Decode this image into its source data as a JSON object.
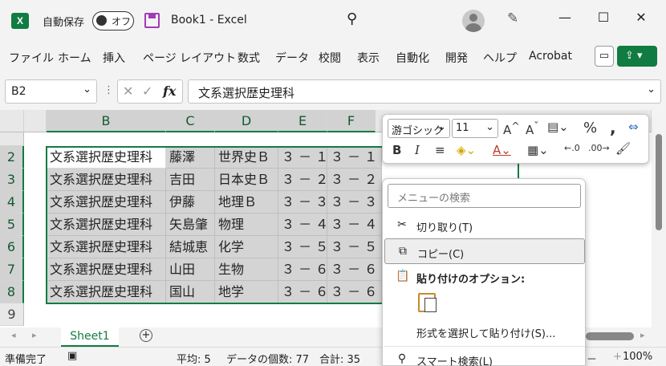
{
  "titlebar": {
    "app_icon": "X",
    "autosave_label": "自動保存",
    "autosave_state": "オフ",
    "doc_title": "Book1  -  Excel",
    "icons": [
      "excel-logo-icon",
      "save-icon",
      "search-icon",
      "avatar",
      "pen-icon"
    ],
    "minimize": "—",
    "maximize": "☐",
    "close": "✕"
  },
  "ribbon": {
    "tabs": [
      "ファイル",
      "ホーム",
      "挿入",
      "ページ レイアウト",
      "数式",
      "データ",
      "校閲",
      "表示",
      "自動化",
      "開発",
      "ヘルプ",
      "Acrobat"
    ],
    "comment_icon": "comment-icon",
    "share_icon": "share-icon"
  },
  "formula_bar": {
    "name_box": "B2",
    "formula": "文系選択歴史理科",
    "fx_label": "fx"
  },
  "grid": {
    "columns": [
      "B",
      "C",
      "D",
      "E",
      "F"
    ],
    "rows": [
      "2",
      "3",
      "4",
      "5",
      "6",
      "7",
      "8",
      "9"
    ],
    "data": [
      [
        "文系選択歴史理科",
        "藤澤",
        "世界史Ｂ",
        "３ － １",
        "３ － １"
      ],
      [
        "文系選択歴史理科",
        "吉田",
        "日本史Ｂ",
        "３ － ２",
        "３ － ２"
      ],
      [
        "文系選択歴史理科",
        "伊藤",
        "地理Ｂ",
        "３ － ３",
        "３ － ３"
      ],
      [
        "文系選択歴史理科",
        "矢島肇",
        "物理",
        "３ － ４",
        "３ － ４"
      ],
      [
        "文系選択歴史理科",
        "結城恵",
        "化学",
        "３ － ５",
        "３ － ５"
      ],
      [
        "文系選択歴史理科",
        "山田",
        "生物",
        "３ － ６",
        "３ － ６"
      ],
      [
        "文系選択歴史理科",
        "国山",
        "地学",
        "３ － ６",
        "３ － ６"
      ]
    ]
  },
  "sheets": {
    "tabs": [
      "Sheet1"
    ]
  },
  "status": {
    "ready": "準備完了",
    "average": "平均: 5",
    "count": "データの個数: 77",
    "sum": "合計: 35",
    "zoom": "100%"
  },
  "mini_toolbar": {
    "font": "游ゴシック",
    "size": "11"
  },
  "context_menu": {
    "search_placeholder": "メニューの検索",
    "cut": "切り取り(T)",
    "copy": "コピー(C)",
    "paste_options": "貼り付けのオプション:",
    "paste_special": "形式を選択して貼り付け(S)...",
    "smart_search": "スマート検索(L)"
  }
}
